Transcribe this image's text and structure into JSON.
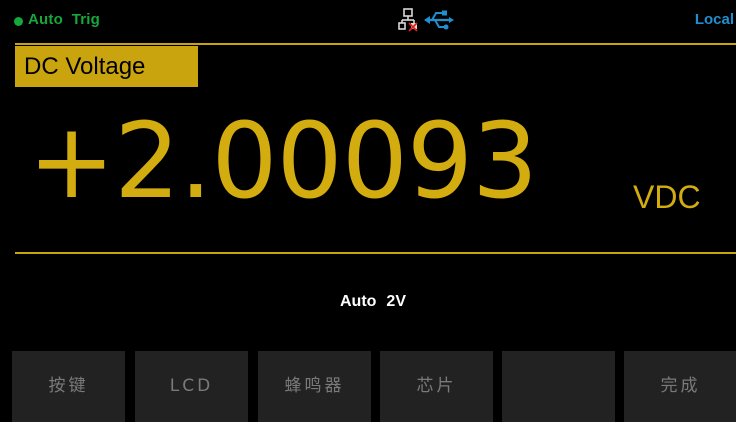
{
  "status_bar": {
    "trigger_mode": "Auto  Trig",
    "trigger_color": "#16a83a",
    "lan_icon": "lan-disconnected-icon",
    "usb_icon": "usb-connected-icon",
    "remote_state": "Local",
    "remote_color": "#1f8fd0"
  },
  "measurement": {
    "function": "DC Voltage",
    "reading": "+2.00093",
    "unit": "VDC",
    "accent_color": "#c9a40e"
  },
  "range": {
    "mode": "Auto",
    "value": "2V"
  },
  "softkeys": [
    {
      "label": "按键"
    },
    {
      "label": "LCD"
    },
    {
      "label": "蜂鸣器"
    },
    {
      "label": "芯片"
    },
    {
      "label": ""
    },
    {
      "label": "完成"
    }
  ]
}
